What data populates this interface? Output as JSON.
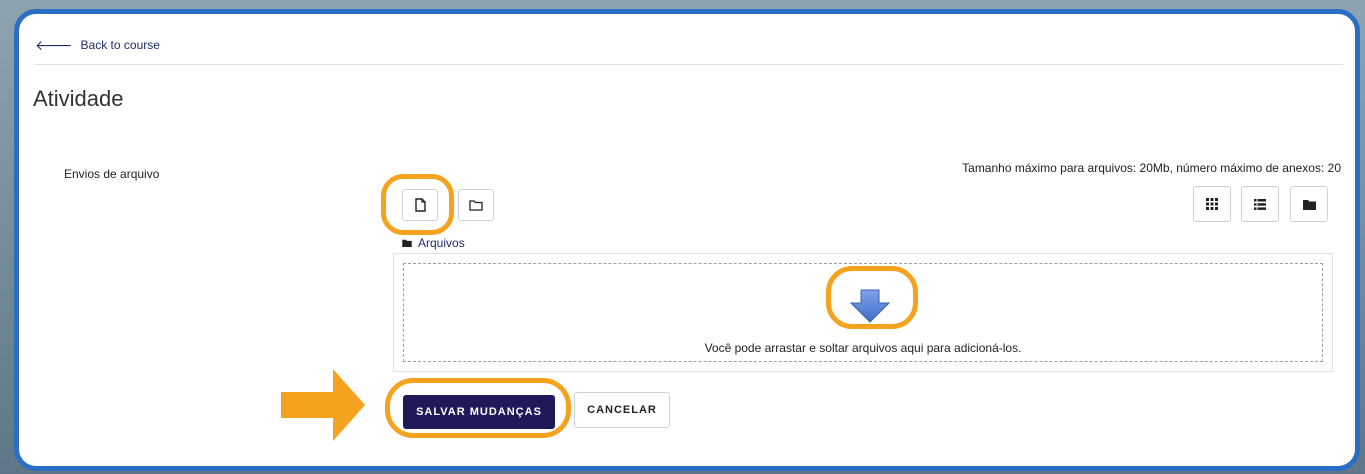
{
  "nav": {
    "back_label": "Back to course"
  },
  "page": {
    "title": "Atividade"
  },
  "form": {
    "field_label": "Envios de arquivo",
    "limits_text": "Tamanho máximo para arquivos: 20Mb, número máximo de anexos: 20",
    "folder_name": "Arquivos",
    "drop_text": "Você pode arrastar e soltar arquivos aqui para adicioná-los.",
    "save_label": "SALVAR MUDANÇAS",
    "cancel_label": "CANCELAR"
  },
  "colors": {
    "frame_border": "#2a6fc4",
    "highlight": "#f5a31f",
    "primary_button": "#1e1a5a",
    "drop_arrow": "#5b87d6"
  },
  "icons": {
    "add_file": "file-icon",
    "create_folder": "folder-outline-icon",
    "view_grid": "grid-icon",
    "view_list": "list-icon",
    "view_tree": "folder-icon"
  }
}
